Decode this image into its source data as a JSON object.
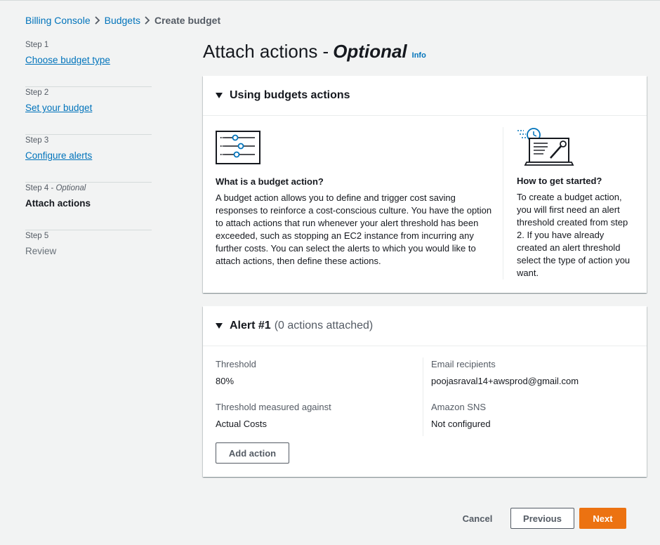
{
  "breadcrumb": {
    "items": [
      "Billing Console",
      "Budgets"
    ],
    "current": "Create budget",
    "separator": ">"
  },
  "steps": [
    {
      "num": "Step 1",
      "label": "Choose budget type"
    },
    {
      "num": "Step 2",
      "label": "Set your budget"
    },
    {
      "num": "Step 3",
      "label": "Configure alerts"
    },
    {
      "num": "Step 4",
      "optional": "Optional",
      "label": "Attach actions"
    },
    {
      "num": "Step 5",
      "label": "Review"
    }
  ],
  "page": {
    "title": "Attach actions -",
    "title_optional": "Optional",
    "info": "Info"
  },
  "using_panel": {
    "header": "Using budgets actions",
    "left": {
      "icon": "sliders-icon",
      "title": "What is a budget action?",
      "text": "A budget action allows you to define and trigger cost saving responses to reinforce a cost-conscious culture. You have the option to attach actions that run whenever your alert threshold has been exceeded, such as stopping an EC2 instance from incurring any further costs. You can select the alerts to which you would like to attach actions, then define these actions."
    },
    "right": {
      "icon": "laptop-wrench-icon",
      "title": "How to get started?",
      "text": "To create a budget action, you will first need an alert threshold created from step 2. If you have already created an alert threshold select the type of action you want."
    }
  },
  "alert_panel": {
    "header": "Alert #1",
    "header_muted": "(0 actions attached)",
    "threshold_label": "Threshold",
    "threshold_value": "80%",
    "measured_label": "Threshold measured against",
    "measured_value": "Actual Costs",
    "email_label": "Email recipients",
    "email_value": "poojasraval14+awsprod@gmail.com",
    "sns_label": "Amazon SNS",
    "sns_value": "Not configured",
    "add_action": "Add action"
  },
  "footer": {
    "cancel": "Cancel",
    "previous": "Previous",
    "next": "Next"
  },
  "colors": {
    "link": "#0073bb",
    "primary": "#ec7211",
    "background": "#f2f3f3",
    "text": "#16191f",
    "muted": "#545b64",
    "icon_accent": "#0073bb"
  }
}
